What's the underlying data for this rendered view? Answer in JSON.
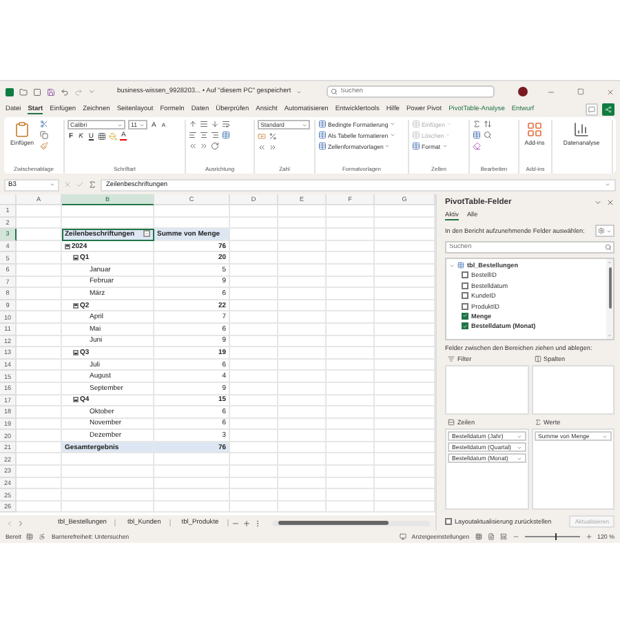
{
  "title_bar": {
    "filename": "business-wissen_9928203...",
    "save_status": "• Auf \"diesem PC\" gespeichert",
    "search": {
      "placeholder": "Suchen"
    }
  },
  "menu_tabs": [
    {
      "label": "Datei",
      "selected": false,
      "kind": "standard"
    },
    {
      "label": "Start",
      "selected": true,
      "kind": "standard"
    },
    {
      "label": "Einfügen",
      "selected": false,
      "kind": "standard"
    },
    {
      "label": "Zeichnen",
      "selected": false,
      "kind": "standard"
    },
    {
      "label": "Seitenlayout",
      "selected": false,
      "kind": "standard"
    },
    {
      "label": "Formeln",
      "selected": false,
      "kind": "standard"
    },
    {
      "label": "Daten",
      "selected": false,
      "kind": "standard"
    },
    {
      "label": "Überprüfen",
      "selected": false,
      "kind": "standard"
    },
    {
      "label": "Ansicht",
      "selected": false,
      "kind": "standard"
    },
    {
      "label": "Automatisieren",
      "selected": false,
      "kind": "standard"
    },
    {
      "label": "Entwicklertools",
      "selected": false,
      "kind": "standard"
    },
    {
      "label": "Hilfe",
      "selected": false,
      "kind": "standard"
    },
    {
      "label": "Power Pivot",
      "selected": false,
      "kind": "standard"
    },
    {
      "label": "PivotTable-Analyse",
      "selected": false,
      "kind": "contextual"
    },
    {
      "label": "Entwurf",
      "selected": false,
      "kind": "contextual"
    }
  ],
  "ribbon": [
    {
      "kind": "clipboard",
      "title": "Zwischenablage",
      "label": "Einfügen"
    },
    {
      "kind": "font",
      "title": "Schriftart",
      "font": "Calibri",
      "size": "11",
      "grow": "A",
      "shrink": "A",
      "styles": [
        "F",
        "K",
        "U"
      ],
      "color_letter": "A"
    },
    {
      "kind": "alignment",
      "title": "Ausrichtung"
    },
    {
      "kind": "number",
      "title": "Zahl",
      "format": "Standard"
    },
    {
      "kind": "styles",
      "title": "Formatvorlagen",
      "buttons": [
        {
          "label": "Bedingte Formatierung",
          "disabled": false
        },
        {
          "label": "Als Tabelle formatieren",
          "disabled": false
        },
        {
          "label": "Zellenformatvorlagen",
          "disabled": false
        }
      ]
    },
    {
      "kind": "cells",
      "title": "Zellen",
      "buttons": [
        {
          "label": "Einfügen",
          "disabled": true
        },
        {
          "label": "Löschen",
          "disabled": true
        },
        {
          "label": "Format",
          "disabled": false
        }
      ]
    },
    {
      "kind": "editing",
      "title": "Bearbeiten"
    },
    {
      "kind": "addins",
      "title": "Add-ins",
      "label": "Add-ins"
    },
    {
      "kind": "analysis",
      "label": "Datenanalyse"
    }
  ],
  "formula_bar": {
    "name_box": "B3",
    "formula": "Zeilenbeschriftungen"
  },
  "sheet": {
    "columns": [
      {
        "label": "A",
        "selected": false
      },
      {
        "label": "B",
        "selected": true
      },
      {
        "label": "C",
        "selected": false
      },
      {
        "label": "D",
        "selected": false
      },
      {
        "label": "E",
        "selected": false
      },
      {
        "label": "F",
        "selected": false
      },
      {
        "label": "G",
        "selected": false
      }
    ],
    "rows": [
      {
        "number": "1",
        "selected": false
      },
      {
        "number": "2",
        "selected": false
      },
      {
        "number": "3",
        "selected": true
      },
      {
        "number": "4",
        "selected": false
      },
      {
        "number": "5",
        "selected": false
      },
      {
        "number": "6",
        "selected": false
      },
      {
        "number": "7",
        "selected": false
      },
      {
        "number": "8",
        "selected": false
      },
      {
        "number": "9",
        "selected": false
      },
      {
        "number": "10",
        "selected": false
      },
      {
        "number": "11",
        "selected": false
      },
      {
        "number": "12",
        "selected": false
      },
      {
        "number": "13",
        "selected": false
      },
      {
        "number": "14",
        "selected": false
      },
      {
        "number": "15",
        "selected": false
      },
      {
        "number": "16",
        "selected": false
      },
      {
        "number": "17",
        "selected": false
      },
      {
        "number": "18",
        "selected": false
      },
      {
        "number": "19",
        "selected": false
      },
      {
        "number": "20",
        "selected": false
      },
      {
        "number": "21",
        "selected": false
      },
      {
        "number": "22",
        "selected": false
      },
      {
        "number": "23",
        "selected": false
      },
      {
        "number": "24",
        "selected": false
      },
      {
        "number": "25",
        "selected": false
      },
      {
        "number": "26",
        "selected": false
      }
    ]
  },
  "pivot": {
    "row_header": "Zeilenbeschriftungen",
    "value_header": "Summe von Menge",
    "items": [
      {
        "label": "2024",
        "value": "76",
        "expanded": true,
        "children": [
          {
            "label": "Q1",
            "value": "20",
            "expanded": true,
            "children": [
              {
                "label": "Januar",
                "value": "5"
              },
              {
                "label": "Februar",
                "value": "9"
              },
              {
                "label": "März",
                "value": "6"
              }
            ]
          },
          {
            "label": "Q2",
            "value": "22",
            "expanded": true,
            "children": [
              {
                "label": "April",
                "value": "7"
              },
              {
                "label": "Mai",
                "value": "6"
              },
              {
                "label": "Juni",
                "value": "9"
              }
            ]
          },
          {
            "label": "Q3",
            "value": "19",
            "expanded": true,
            "children": [
              {
                "label": "Juli",
                "value": "6"
              },
              {
                "label": "August",
                "value": "4"
              },
              {
                "label": "September",
                "value": "9"
              }
            ]
          },
          {
            "label": "Q4",
            "value": "15",
            "expanded": true,
            "children": [
              {
                "label": "Oktober",
                "value": "6"
              },
              {
                "label": "November",
                "value": "6"
              },
              {
                "label": "Dezember",
                "value": "3"
              }
            ]
          }
        ]
      }
    ],
    "total": {
      "label": "Gesamtergebnis",
      "value": "76"
    }
  },
  "sheet_tabs": [
    {
      "label": "tbl_Bestellungen",
      "selected": false
    },
    {
      "label": "tbl_Kunden",
      "selected": false
    },
    {
      "label": "tbl_Produkte",
      "selected": false
    }
  ],
  "pivot_fields": {
    "title": "PivotTable-Felder",
    "tabs": [
      {
        "label": "Aktiv",
        "selected": true
      },
      {
        "label": "Alle",
        "selected": false
      }
    ],
    "instruction": "In den Bericht aufzunehmende Felder auswählen:",
    "search": {
      "placeholder": "Suchen"
    },
    "tables": [
      {
        "label": "tbl_Bestellungen",
        "expanded": true,
        "children": [
          {
            "label": "BestellID",
            "checked": false
          },
          {
            "label": "Bestelldatum",
            "checked": false
          },
          {
            "label": "KundeID",
            "checked": false
          },
          {
            "label": "ProduktID",
            "checked": false
          },
          {
            "label": "Menge",
            "checked": true
          },
          {
            "label": "Bestelldatum (Monat)",
            "checked": true
          }
        ]
      }
    ],
    "areas_hint": "Felder zwischen den Bereichen ziehen und ablegen:",
    "areas": [
      {
        "kind": "filter",
        "label": "Filter"
      },
      {
        "kind": "columns",
        "label": "Spalten"
      },
      {
        "kind": "rows",
        "label": "Zeilen",
        "fields": [
          "Bestelldatum (Jahr)",
          "Bestelldatum (Quartal)",
          "Bestelldatum (Monat)"
        ]
      },
      {
        "kind": "values",
        "label": "Werte",
        "fields": [
          "Summe von Menge"
        ]
      }
    ],
    "defer": {
      "label": "Layoutaktualisierung zurückstellen",
      "checked": false
    },
    "update_button": {
      "label": "Aktualisieren",
      "disabled": true
    }
  },
  "status_bar": {
    "ready": "Bereit",
    "accessibility": "Barrierefreiheit: Untersuchen",
    "display": "Anzeigeeinstellungen",
    "zoom": {
      "level": 0.55,
      "reading": "120 %"
    }
  }
}
